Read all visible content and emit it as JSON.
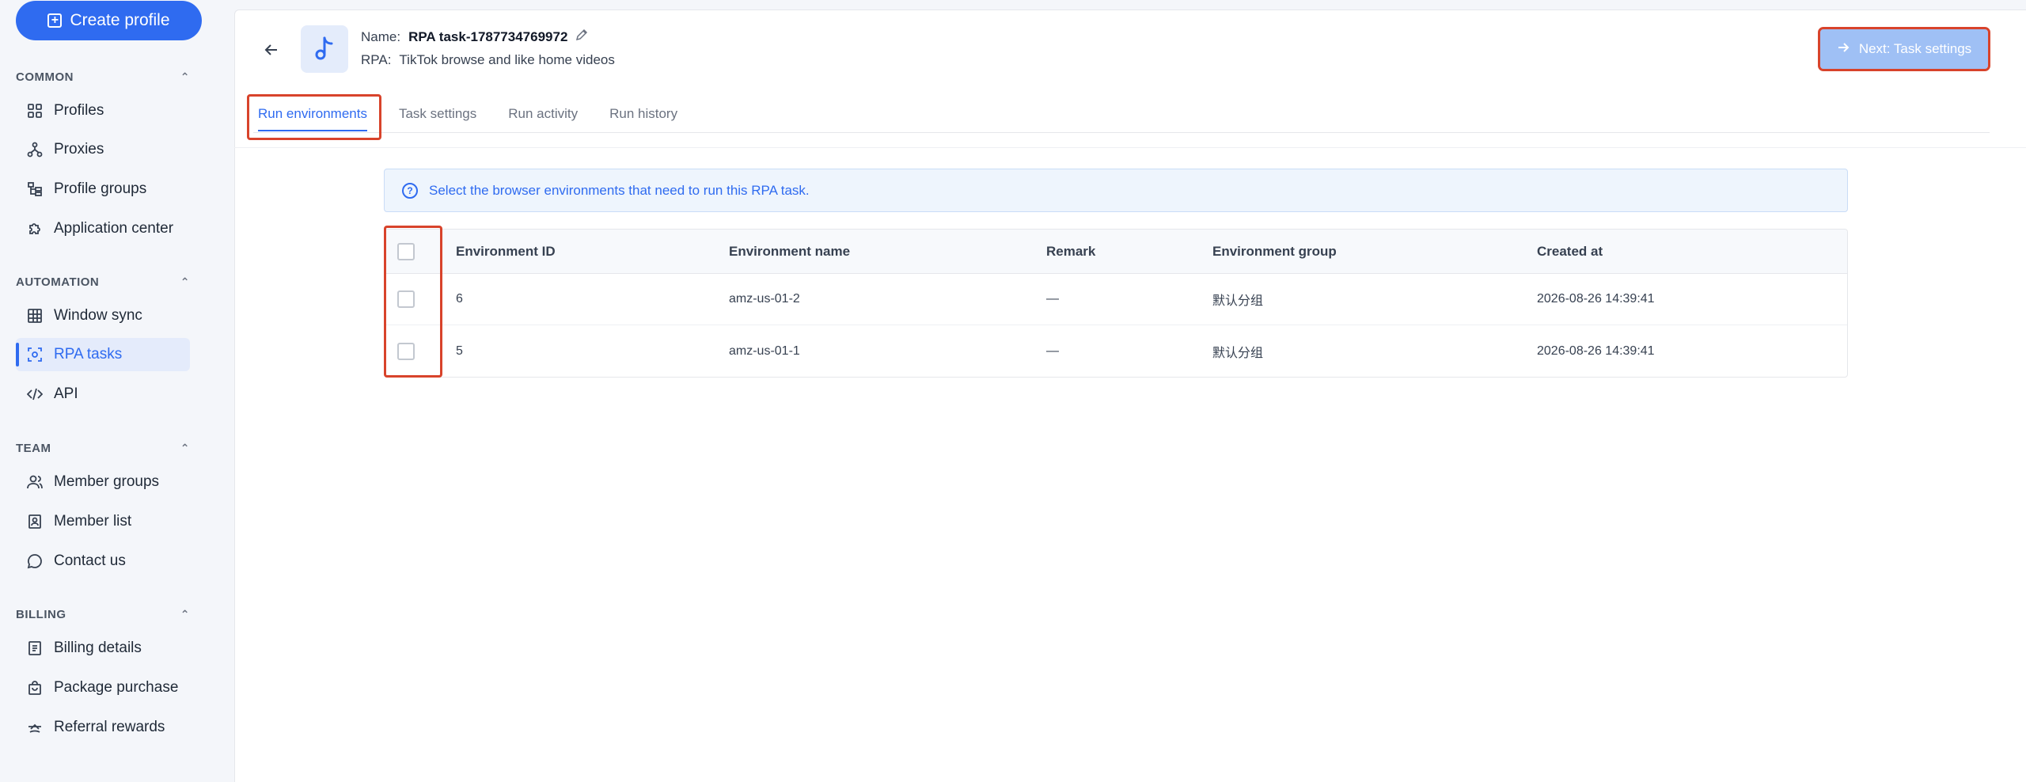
{
  "sidebar": {
    "create_label": "Create profile",
    "sections": {
      "common": "COMMON",
      "automation": "AUTOMATION",
      "team": "TEAM",
      "billing": "BILLING"
    },
    "items": {
      "profiles": "Profiles",
      "proxies": "Proxies",
      "profile_groups": "Profile groups",
      "application_center": "Application center",
      "window_sync": "Window sync",
      "rpa_tasks": "RPA tasks",
      "api": "API",
      "member_groups": "Member groups",
      "member_list": "Member list",
      "contact_us": "Contact us",
      "billing_details": "Billing details",
      "package_purchase": "Package purchase",
      "referral_rewards": "Referral rewards"
    },
    "active_item": "RPA tasks"
  },
  "header": {
    "name_label": "Name:",
    "name_value": "RPA task-1787734769972",
    "rpa_label": "RPA:",
    "rpa_value": "TikTok browse and like home videos",
    "next_button": "Next: Task settings"
  },
  "tabs": [
    {
      "label": "Run environments",
      "active": true
    },
    {
      "label": "Task settings",
      "active": false
    },
    {
      "label": "Run activity",
      "active": false
    },
    {
      "label": "Run history",
      "active": false
    }
  ],
  "info_text": "Select the browser environments that need to run this RPA task.",
  "table": {
    "headers": {
      "id": "Environment ID",
      "name": "Environment name",
      "remark": "Remark",
      "group": "Environment group",
      "created": "Created at"
    },
    "rows": [
      {
        "id": "6",
        "name": "amz-us-01-2",
        "remark": "—",
        "group": "默认分组",
        "created": "2026-08-26 14:39:41"
      },
      {
        "id": "5",
        "name": "amz-us-01-1",
        "remark": "—",
        "group": "默认分组",
        "created": "2026-08-26 14:39:41"
      }
    ]
  },
  "colors": {
    "accent": "#2f6bf0",
    "highlight": "#d8432b",
    "next_button_bg": "#9fc0f5"
  }
}
